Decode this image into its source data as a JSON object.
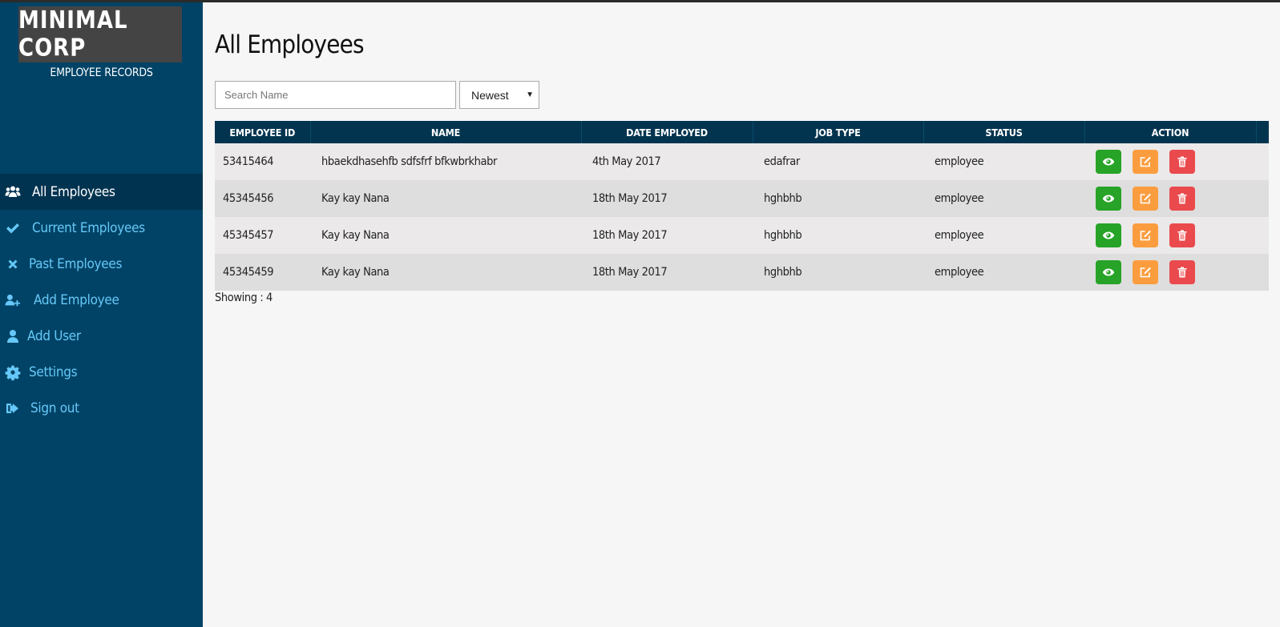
{
  "brand": {
    "logo_text": "MINIMAL CORP",
    "subtitle": "EMPLOYEE RECORDS"
  },
  "sidebar": {
    "items": [
      {
        "label": "All Employees",
        "icon": "users-icon",
        "active": true
      },
      {
        "label": "Current Employees",
        "icon": "check-icon",
        "active": false
      },
      {
        "label": "Past Employees",
        "icon": "times-icon",
        "active": false
      },
      {
        "label": "Add Employee",
        "icon": "user-plus-icon",
        "active": false
      },
      {
        "label": "Add User",
        "icon": "user-icon",
        "active": false
      },
      {
        "label": "Settings",
        "icon": "gear-icon",
        "active": false
      },
      {
        "label": "Sign out",
        "icon": "sign-out-icon",
        "active": false
      }
    ]
  },
  "main": {
    "title": "All Employees",
    "search": {
      "placeholder": "Search Name",
      "value": ""
    },
    "sort": {
      "selected": "Newest"
    },
    "table": {
      "columns": [
        "EMPLOYEE ID",
        "NAME",
        "DATE EMPLOYED",
        "JOB TYPE",
        "STATUS",
        "ACTION"
      ],
      "rows": [
        {
          "id": "53415464",
          "name": "hbaekdhasehfb sdfsfrf bfkwbrkhabr",
          "date": "4th May 2017",
          "job": "edafrar",
          "status": "employee"
        },
        {
          "id": "45345456",
          "name": "Kay kay Nana",
          "date": "18th May 2017",
          "job": "hghbhb",
          "status": "employee"
        },
        {
          "id": "45345457",
          "name": "Kay kay Nana",
          "date": "18th May 2017",
          "job": "hghbhb",
          "status": "employee"
        },
        {
          "id": "45345459",
          "name": "Kay kay Nana",
          "date": "18th May 2017",
          "job": "hghbhb",
          "status": "employee"
        }
      ],
      "actions": [
        {
          "name": "view",
          "icon": "eye-icon",
          "color": "#27a327"
        },
        {
          "name": "edit",
          "icon": "edit-icon",
          "color": "#fb9d3f"
        },
        {
          "name": "delete",
          "icon": "trash-icon",
          "color": "#ea4a4d"
        }
      ]
    },
    "showing_text": "Showing : 4"
  },
  "colors": {
    "sidebar_bg": "#014366",
    "sidebar_active_bg": "#003350",
    "sidebar_link": "#66c8f8",
    "table_header_bg": "#02344f",
    "page_bg": "#f6f6f6"
  }
}
